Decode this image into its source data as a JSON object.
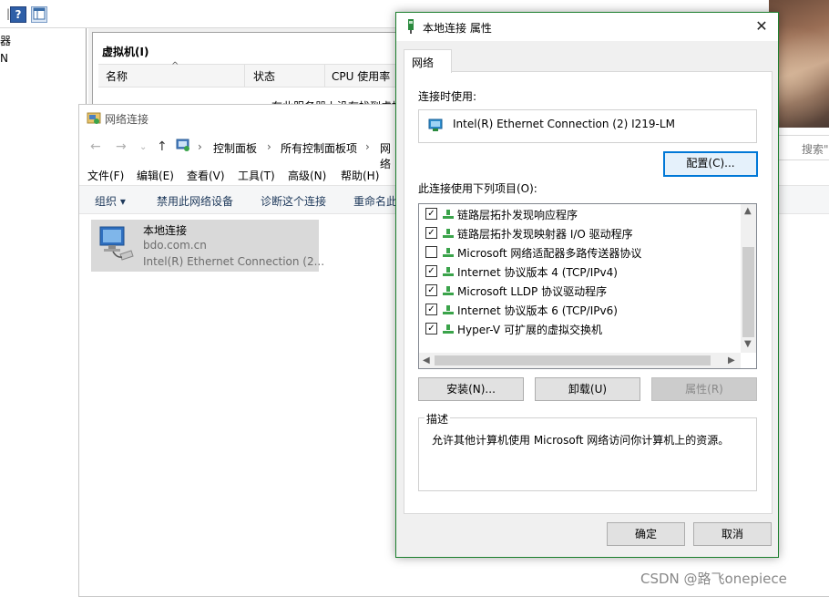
{
  "hyperv": {
    "left_items": [
      "器",
      "N"
    ],
    "vm_panel_title": "虚拟机(I)",
    "columns": [
      "名称",
      "状态",
      "CPU 使用率"
    ],
    "empty_message": "在此服务器上没有找到虚拟机"
  },
  "network_window": {
    "title": "网络连接",
    "breadcrumb": [
      "控制面板",
      "所有控制面板项",
      "网络"
    ],
    "search_placeholder": "搜索\"",
    "menu": [
      "文件(F)",
      "编辑(E)",
      "查看(V)",
      "工具(T)",
      "高级(N)",
      "帮助(H)"
    ],
    "commands": [
      "组织 ▾",
      "禁用此网络设备",
      "诊断这个连接",
      "重命名此"
    ],
    "connection": {
      "name": "本地连接",
      "domain": "bdo.com.cn",
      "adapter": "Intel(R) Ethernet Connection (2..."
    }
  },
  "dialog": {
    "title": "本地连接 属性",
    "tab": "网络",
    "connect_using_label": "连接时使用:",
    "adapter_name": "Intel(R) Ethernet Connection (2) I219-LM",
    "configure_button": "配置(C)...",
    "items_label": "此连接使用下列项目(O):",
    "items": [
      {
        "label": "链路层拓扑发现响应程序",
        "checked": true
      },
      {
        "label": "链路层拓扑发现映射器 I/O 驱动程序",
        "checked": true
      },
      {
        "label": "Microsoft 网络适配器多路传送器协议",
        "checked": false
      },
      {
        "label": "Internet 协议版本 4 (TCP/IPv4)",
        "checked": true
      },
      {
        "label": "Microsoft LLDP 协议驱动程序",
        "checked": true
      },
      {
        "label": "Internet 协议版本 6 (TCP/IPv6)",
        "checked": true
      },
      {
        "label": "Hyper-V 可扩展的虚拟交换机",
        "checked": true
      }
    ],
    "install_button": "安装(N)...",
    "uninstall_button": "卸载(U)",
    "properties_button": "属性(R)",
    "description_legend": "描述",
    "description_text": "允许其他计算机使用 Microsoft 网络访问你计算机上的资源。",
    "ok_button": "确定",
    "cancel_button": "取消"
  },
  "watermark": "CSDN @路飞onepiece",
  "colors": {
    "dialog_border": "#1b7f2d",
    "focus_blue": "#0078d7",
    "protocol_green": "#3aa34a"
  }
}
